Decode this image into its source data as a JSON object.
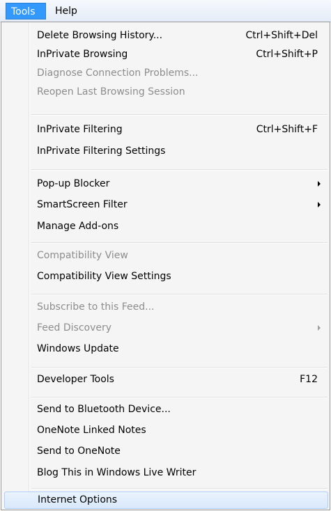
{
  "menubar": {
    "tools_label": "Tools",
    "help_label": "Help"
  },
  "menu": {
    "items": [
      {
        "label": "Delete Browsing History...",
        "shortcut": "Ctrl+Shift+Del",
        "enabled": true
      },
      {
        "label": "InPrivate Browsing",
        "shortcut": "Ctrl+Shift+P",
        "enabled": true
      },
      {
        "label": "Diagnose Connection Problems...",
        "enabled": false
      },
      {
        "label": "Reopen Last Browsing Session",
        "enabled": false
      },
      {
        "label": "InPrivate Filtering",
        "shortcut": "Ctrl+Shift+F",
        "enabled": true
      },
      {
        "label": "InPrivate Filtering Settings",
        "enabled": true
      },
      {
        "label": "Pop-up Blocker",
        "submenu": true,
        "enabled": true
      },
      {
        "label": "SmartScreen Filter",
        "submenu": true,
        "enabled": true
      },
      {
        "label": "Manage Add-ons",
        "enabled": true
      },
      {
        "label": "Compatibility View",
        "enabled": false
      },
      {
        "label": "Compatibility View Settings",
        "enabled": true
      },
      {
        "label": "Subscribe to this Feed...",
        "enabled": false
      },
      {
        "label": "Feed Discovery",
        "submenu": true,
        "enabled": false
      },
      {
        "label": "Windows Update",
        "enabled": true
      },
      {
        "label": "Developer Tools",
        "shortcut": "F12",
        "enabled": true
      },
      {
        "label": "Send to Bluetooth Device...",
        "enabled": true
      },
      {
        "label": "OneNote Linked Notes",
        "enabled": true
      },
      {
        "label": "Send to OneNote",
        "enabled": true
      },
      {
        "label": "Blog This in Windows Live Writer",
        "enabled": true
      },
      {
        "label": "Internet Options",
        "enabled": true,
        "highlighted": true
      }
    ]
  },
  "colors": {
    "menubar_active_bg": "#3399ff",
    "disabled_text": "#8d8d8d",
    "highlight_border": "#aecff7"
  }
}
